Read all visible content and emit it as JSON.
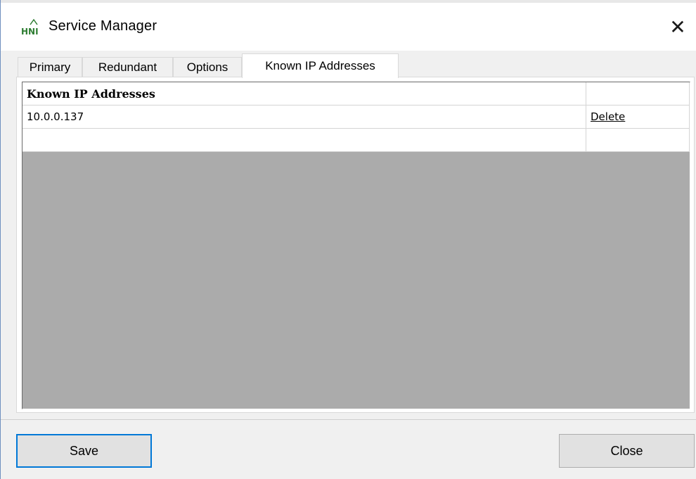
{
  "window": {
    "title": "Service Manager",
    "app_icon_text": "HNI",
    "close_glyph": "✕"
  },
  "tabs": [
    {
      "label": "Primary",
      "active": false
    },
    {
      "label": "Redundant",
      "active": false
    },
    {
      "label": "Options",
      "active": false
    },
    {
      "label": "Known IP Addresses",
      "active": true
    }
  ],
  "grid": {
    "columns": [
      "Known IP Addresses",
      ""
    ],
    "rows": [
      {
        "ip": "10.0.0.137",
        "action": "Delete"
      },
      {
        "ip": "",
        "action": ""
      }
    ]
  },
  "buttons": {
    "save_label": "Save",
    "close_label": "Close"
  },
  "colors": {
    "grid_background": "#ababab",
    "default_button_border": "#0078d7",
    "window_background": "#f0f0f0"
  }
}
